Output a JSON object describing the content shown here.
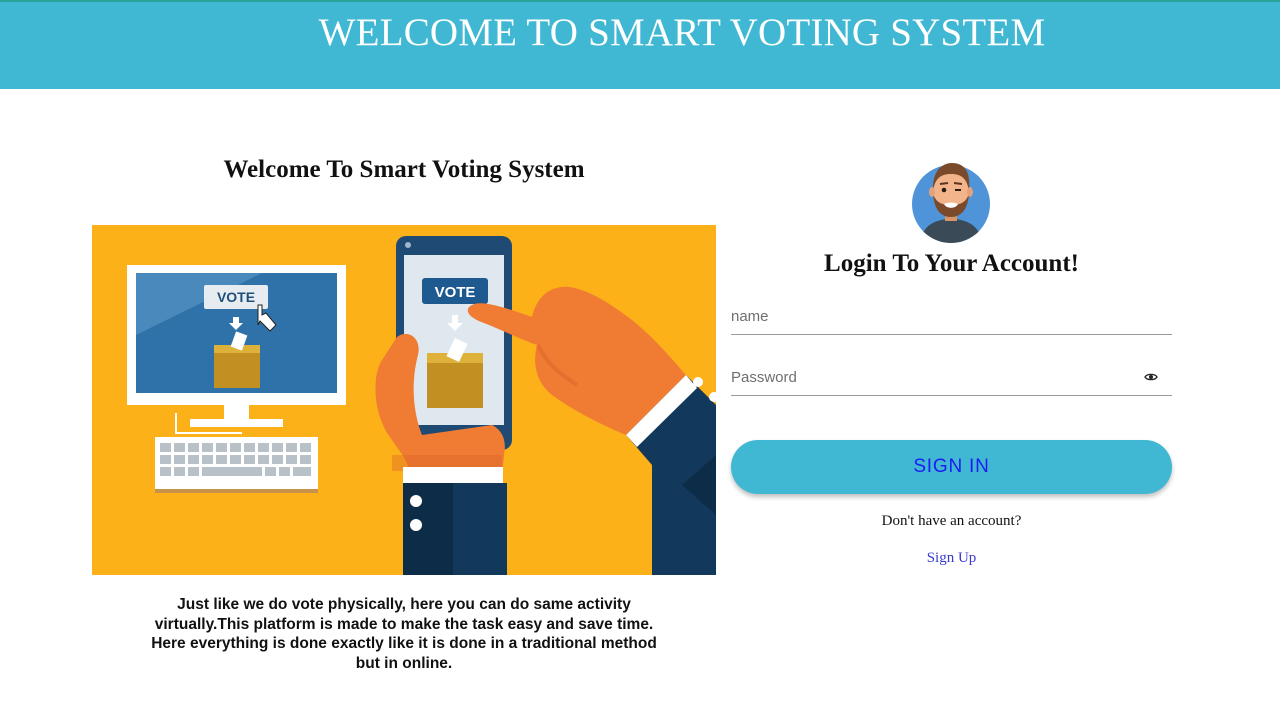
{
  "header": {
    "title": "WELCOME TO SMART VOTING SYSTEM"
  },
  "left": {
    "title": "Welcome To Smart Voting System",
    "illustration": {
      "vote_label_monitor": "VOTE",
      "vote_label_phone": "VOTE"
    },
    "description_lines": [
      "Just like we do vote physically, here you can do same activity",
      "virtually.This platform is made to make the task easy and save time.",
      "Here everything is done exactly like it is done in a traditional method",
      "but in online."
    ]
  },
  "login": {
    "title": "Login To Your Account!",
    "name_placeholder": "name",
    "password_placeholder": "Password",
    "password_toggle_icon": "eye-icon",
    "signin_label": "SIGN IN",
    "no_account_text": "Don't have an account?",
    "signup_label": "Sign Up"
  },
  "colors": {
    "header_bg": "#41b8d3",
    "button_bg": "#41b8d3",
    "button_text": "#1c1cf0",
    "link": "#3b3bd0",
    "illustration_bg": "#fdb118"
  }
}
